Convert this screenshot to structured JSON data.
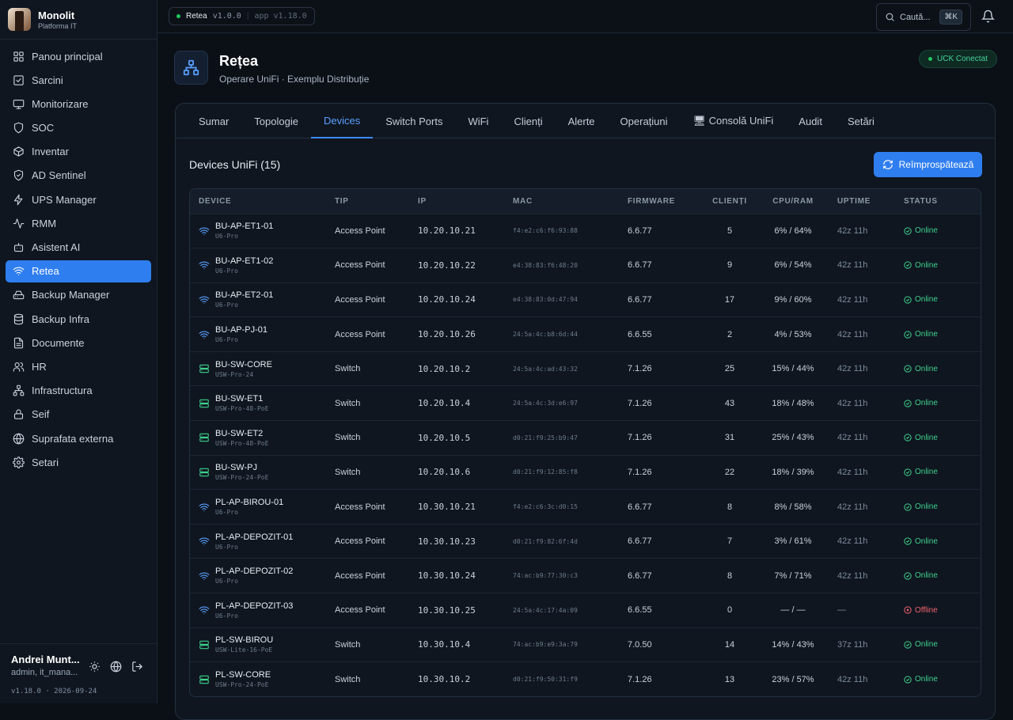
{
  "brand": {
    "title": "Monolit",
    "subtitle": "Platforma IT"
  },
  "sidebar": {
    "items": [
      {
        "label": "Panou principal",
        "icon": "grid-icon"
      },
      {
        "label": "Sarcini",
        "icon": "checkbox-icon"
      },
      {
        "label": "Monitorizare",
        "icon": "monitor-icon"
      },
      {
        "label": "SOC",
        "icon": "shield-icon"
      },
      {
        "label": "Inventar",
        "icon": "box-icon"
      },
      {
        "label": "AD Sentinel",
        "icon": "shield-check-icon"
      },
      {
        "label": "UPS Manager",
        "icon": "bolt-icon"
      },
      {
        "label": "RMM",
        "icon": "activity-icon"
      },
      {
        "label": "Asistent AI",
        "icon": "bot-icon"
      },
      {
        "label": "Retea",
        "icon": "wifi-icon",
        "active": true
      },
      {
        "label": "Backup Manager",
        "icon": "hard-drive-icon"
      },
      {
        "label": "Backup Infra",
        "icon": "database-icon"
      },
      {
        "label": "Documente",
        "icon": "file-icon"
      },
      {
        "label": "HR",
        "icon": "users-icon"
      },
      {
        "label": "Infrastructura",
        "icon": "network-icon"
      },
      {
        "label": "Seif",
        "icon": "lock-icon"
      },
      {
        "label": "Suprafata externa",
        "icon": "globe-icon"
      },
      {
        "label": "Setari",
        "icon": "gear-icon"
      }
    ]
  },
  "footer": {
    "user_name": "Andrei Munt...",
    "user_role": "admin, it_mana...",
    "version": "v1.18.0 · 2026-09-24"
  },
  "topbar": {
    "section": "Retea",
    "section_version": "v1.0.0",
    "app_version": "app v1.18.0",
    "search_placeholder": "Caută...",
    "search_shortcut": "⌘K"
  },
  "page": {
    "title": "Rețea",
    "subtitle": "Operare UniFi · Exemplu Distribuție",
    "connection_status": "UCK Conectat"
  },
  "tabs": [
    "Sumar",
    "Topologie",
    "Devices",
    "Switch Ports",
    "WiFi",
    "Clienți",
    "Alerte",
    "Operațiuni",
    "🖥 Consolă UniFi",
    "Audit",
    "Setări"
  ],
  "active_tab": "Devices",
  "section": {
    "title": "Devices UniFi (15)",
    "refresh_label": "Reîmprospătează"
  },
  "table": {
    "headers": [
      "DEVICE",
      "TIP",
      "IP",
      "MAC",
      "FIRMWARE",
      "CLIENȚI",
      "CPU/RAM",
      "UPTIME",
      "STATUS"
    ],
    "rows": [
      {
        "kind": "ap",
        "name": "BU-AP-ET1-01",
        "model": "U6-Pro",
        "type": "Access Point",
        "ip": "10.20.10.21",
        "mac": "f4:e2:c6:f6:93:88",
        "firmware": "6.6.77",
        "clients": "5",
        "cpu_ram": "6% / 64%",
        "uptime": "42z 11h",
        "status": "Online"
      },
      {
        "kind": "ap",
        "name": "BU-AP-ET1-02",
        "model": "U6-Pro",
        "type": "Access Point",
        "ip": "10.20.10.22",
        "mac": "e4:38:83:f6:48:20",
        "firmware": "6.6.77",
        "clients": "9",
        "cpu_ram": "6% / 54%",
        "uptime": "42z 11h",
        "status": "Online"
      },
      {
        "kind": "ap",
        "name": "BU-AP-ET2-01",
        "model": "U6-Pro",
        "type": "Access Point",
        "ip": "10.20.10.24",
        "mac": "e4:38:83:0d:47:94",
        "firmware": "6.6.77",
        "clients": "17",
        "cpu_ram": "9% / 60%",
        "uptime": "42z 11h",
        "status": "Online"
      },
      {
        "kind": "ap",
        "name": "BU-AP-PJ-01",
        "model": "U6-Pro",
        "type": "Access Point",
        "ip": "10.20.10.26",
        "mac": "24:5a:4c:b8:6d:44",
        "firmware": "6.6.55",
        "clients": "2",
        "cpu_ram": "4% / 53%",
        "uptime": "42z 11h",
        "status": "Online"
      },
      {
        "kind": "sw",
        "name": "BU-SW-CORE",
        "model": "USW-Pro-24",
        "type": "Switch",
        "ip": "10.20.10.2",
        "mac": "24:5a:4c:ad:43:32",
        "firmware": "7.1.26",
        "clients": "25",
        "cpu_ram": "15% / 44%",
        "uptime": "42z 11h",
        "status": "Online"
      },
      {
        "kind": "sw",
        "name": "BU-SW-ET1",
        "model": "USW-Pro-48-PoE",
        "type": "Switch",
        "ip": "10.20.10.4",
        "mac": "24:5a:4c:3d:e6:97",
        "firmware": "7.1.26",
        "clients": "43",
        "cpu_ram": "18% / 48%",
        "uptime": "42z 11h",
        "status": "Online"
      },
      {
        "kind": "sw",
        "name": "BU-SW-ET2",
        "model": "USW-Pro-48-PoE",
        "type": "Switch",
        "ip": "10.20.10.5",
        "mac": "d0:21:f9:25:b9:47",
        "firmware": "7.1.26",
        "clients": "31",
        "cpu_ram": "25% / 43%",
        "uptime": "42z 11h",
        "status": "Online"
      },
      {
        "kind": "sw",
        "name": "BU-SW-PJ",
        "model": "USW-Pro-24-PoE",
        "type": "Switch",
        "ip": "10.20.10.6",
        "mac": "d0:21:f9:12:85:f8",
        "firmware": "7.1.26",
        "clients": "22",
        "cpu_ram": "18% / 39%",
        "uptime": "42z 11h",
        "status": "Online"
      },
      {
        "kind": "ap",
        "name": "PL-AP-BIROU-01",
        "model": "U6-Pro",
        "type": "Access Point",
        "ip": "10.30.10.21",
        "mac": "f4:e2:c6:3c:d0:15",
        "firmware": "6.6.77",
        "clients": "8",
        "cpu_ram": "8% / 58%",
        "uptime": "42z 11h",
        "status": "Online"
      },
      {
        "kind": "ap",
        "name": "PL-AP-DEPOZIT-01",
        "model": "U6-Pro",
        "type": "Access Point",
        "ip": "10.30.10.23",
        "mac": "d0:21:f9:82:6f:4d",
        "firmware": "6.6.77",
        "clients": "7",
        "cpu_ram": "3% / 61%",
        "uptime": "42z 11h",
        "status": "Online"
      },
      {
        "kind": "ap",
        "name": "PL-AP-DEPOZIT-02",
        "model": "U6-Pro",
        "type": "Access Point",
        "ip": "10.30.10.24",
        "mac": "74:ac:b9:77:30:c3",
        "firmware": "6.6.77",
        "clients": "8",
        "cpu_ram": "7% / 71%",
        "uptime": "42z 11h",
        "status": "Online"
      },
      {
        "kind": "ap",
        "name": "PL-AP-DEPOZIT-03",
        "model": "U6-Pro",
        "type": "Access Point",
        "ip": "10.30.10.25",
        "mac": "24:5a:4c:17:4a:09",
        "firmware": "6.6.55",
        "clients": "0",
        "cpu_ram": "— / —",
        "uptime": "—",
        "status": "Offline"
      },
      {
        "kind": "sw",
        "name": "PL-SW-BIROU",
        "model": "USW-Lite-16-PoE",
        "type": "Switch",
        "ip": "10.30.10.4",
        "mac": "74:ac:b9:e9:3a:79",
        "firmware": "7.0.50",
        "clients": "14",
        "cpu_ram": "14% / 43%",
        "uptime": "37z 11h",
        "status": "Online"
      },
      {
        "kind": "sw",
        "name": "PL-SW-CORE",
        "model": "USW-Pro-24-PoE",
        "type": "Switch",
        "ip": "10.30.10.2",
        "mac": "d0:21:f9:50:31:f9",
        "firmware": "7.1.26",
        "clients": "13",
        "cpu_ram": "23% / 57%",
        "uptime": "42z 11h",
        "status": "Online"
      }
    ]
  },
  "colors": {
    "accent": "#2f7ef0",
    "online": "#3fd18b",
    "offline": "#f0616d",
    "switch_icon": "#3fd18b",
    "ap_icon": "#5aa0ff"
  }
}
